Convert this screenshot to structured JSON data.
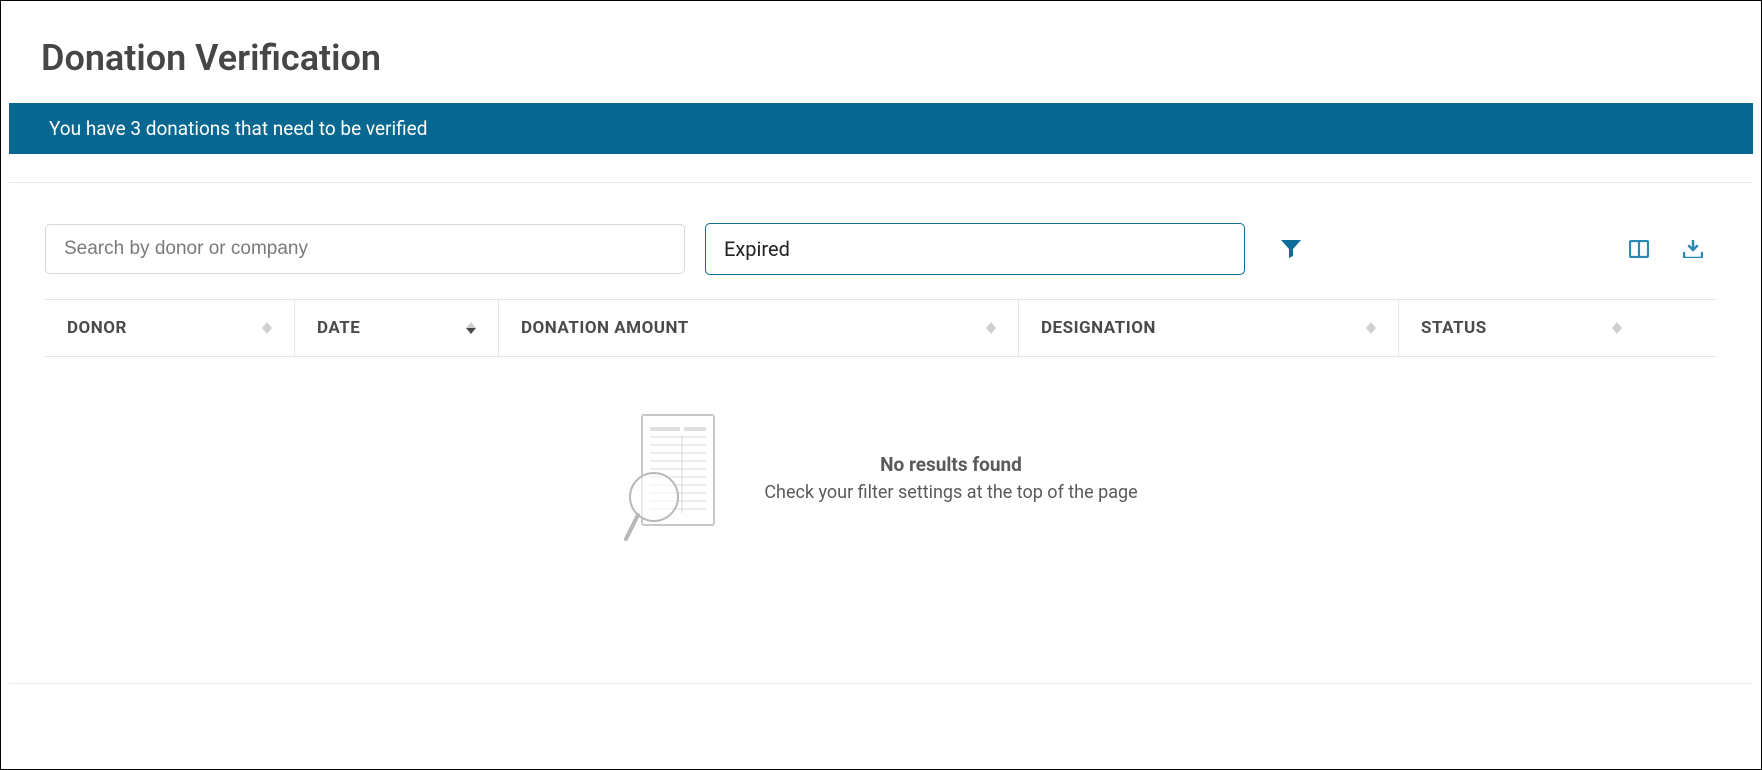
{
  "header": {
    "title": "Donation Verification"
  },
  "notification": {
    "message": "You have 3 donations that need to be verified"
  },
  "toolbar": {
    "search_placeholder": "Search by donor or company",
    "filter_value": "Expired"
  },
  "table": {
    "columns": {
      "donor": "DONOR",
      "date": "DATE",
      "amount": "DONATION AMOUNT",
      "designation": "DESIGNATION",
      "status": "STATUS"
    }
  },
  "empty_state": {
    "title": "No results found",
    "subtitle": "Check your filter settings at the top of the page"
  }
}
